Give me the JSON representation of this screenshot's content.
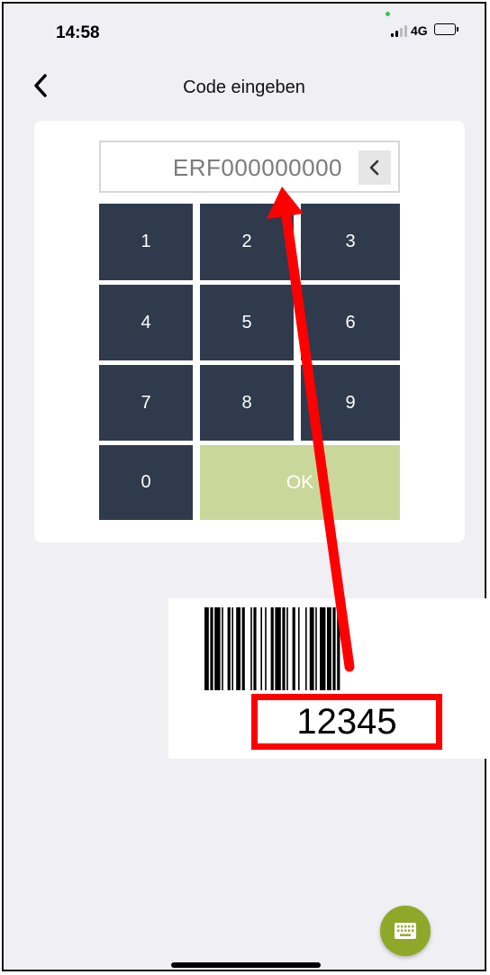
{
  "status_bar": {
    "time": "14:58",
    "network": "4G"
  },
  "nav": {
    "title": "Code eingeben"
  },
  "code_input": {
    "value": "ERF000000000"
  },
  "keypad": {
    "keys": [
      "1",
      "2",
      "3",
      "4",
      "5",
      "6",
      "7",
      "8",
      "9",
      "0"
    ],
    "ok_label": "OK"
  },
  "annotation": {
    "barcode_number": "12345"
  },
  "colors": {
    "key_background": "#2f3a4d",
    "ok_background": "#cad79a",
    "fab_background": "#8fa82a",
    "annotation_red": "#ff0000"
  },
  "icons": {
    "back": "chevron-left-icon",
    "backspace": "chevron-left-icon",
    "fab": "keyboard-icon"
  }
}
